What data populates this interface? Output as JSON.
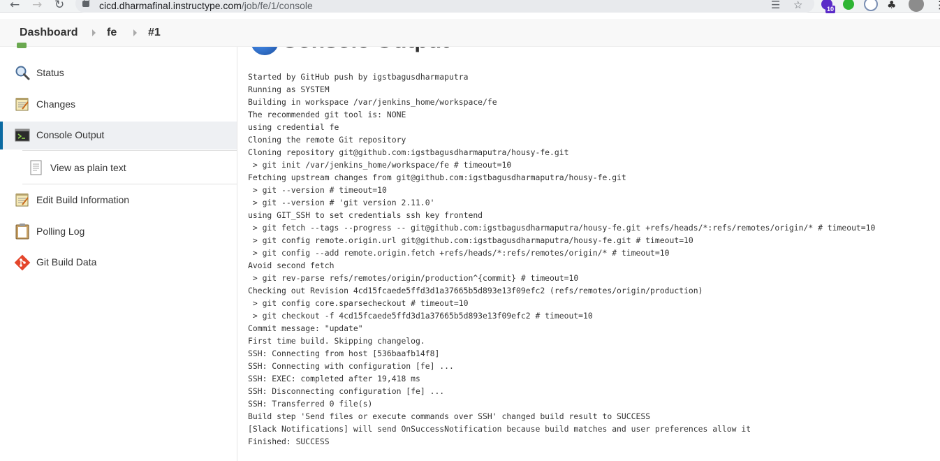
{
  "browser": {
    "url_host": "cicd.dharmafinal.instructype.com",
    "url_path": "/job/fe/1/console",
    "extension_badge": "10"
  },
  "breadcrumb": {
    "items": [
      "Dashboard",
      "fe",
      "#1"
    ]
  },
  "sidebar": {
    "items": [
      {
        "label": "Status",
        "icon": "magnifier-icon"
      },
      {
        "label": "Changes",
        "icon": "notepad-icon"
      },
      {
        "label": "Console Output",
        "icon": "terminal-icon",
        "active": true
      },
      {
        "label": "View as plain text",
        "icon": "document-icon"
      },
      {
        "label": "Edit Build Information",
        "icon": "notepad-edit-icon"
      },
      {
        "label": "Polling Log",
        "icon": "clipboard-icon"
      },
      {
        "label": "Git Build Data",
        "icon": "git-icon"
      }
    ]
  },
  "main": {
    "title": "Console Output",
    "console_lines": [
      "Started by GitHub push by igstbagusdharmaputra",
      "Running as SYSTEM",
      "Building in workspace /var/jenkins_home/workspace/fe",
      "The recommended git tool is: NONE",
      "using credential fe",
      "Cloning the remote Git repository",
      "Cloning repository git@github.com:igstbagusdharmaputra/housy-fe.git",
      " > git init /var/jenkins_home/workspace/fe # timeout=10",
      "Fetching upstream changes from git@github.com:igstbagusdharmaputra/housy-fe.git",
      " > git --version # timeout=10",
      " > git --version # 'git version 2.11.0'",
      "using GIT_SSH to set credentials ssh key frontend",
      " > git fetch --tags --progress -- git@github.com:igstbagusdharmaputra/housy-fe.git +refs/heads/*:refs/remotes/origin/* # timeout=10",
      " > git config remote.origin.url git@github.com:igstbagusdharmaputra/housy-fe.git # timeout=10",
      " > git config --add remote.origin.fetch +refs/heads/*:refs/remotes/origin/* # timeout=10",
      "Avoid second fetch",
      " > git rev-parse refs/remotes/origin/production^{commit} # timeout=10",
      "Checking out Revision 4cd15fcaede5ffd3d1a37665b5d893e13f09efc2 (refs/remotes/origin/production)",
      " > git config core.sparsecheckout # timeout=10",
      " > git checkout -f 4cd15fcaede5ffd3d1a37665b5d893e13f09efc2 # timeout=10",
      "Commit message: \"update\"",
      "First time build. Skipping changelog.",
      "SSH: Connecting from host [536baafb14f8]",
      "SSH: Connecting with configuration [fe] ...",
      "SSH: EXEC: completed after 19,418 ms",
      "SSH: Disconnecting configuration [fe] ...",
      "SSH: Transferred 0 file(s)",
      "Build step 'Send files or execute commands over SSH' changed build result to SUCCESS",
      "[Slack Notifications] will send OnSuccessNotification because build matches and user preferences allow it",
      "Finished: SUCCESS"
    ]
  },
  "colors": {
    "active_accent": "#0b6aa2",
    "sidebar_active_bg": "#eef0f3",
    "breadcrumb_bg": "#f8f8f8"
  }
}
